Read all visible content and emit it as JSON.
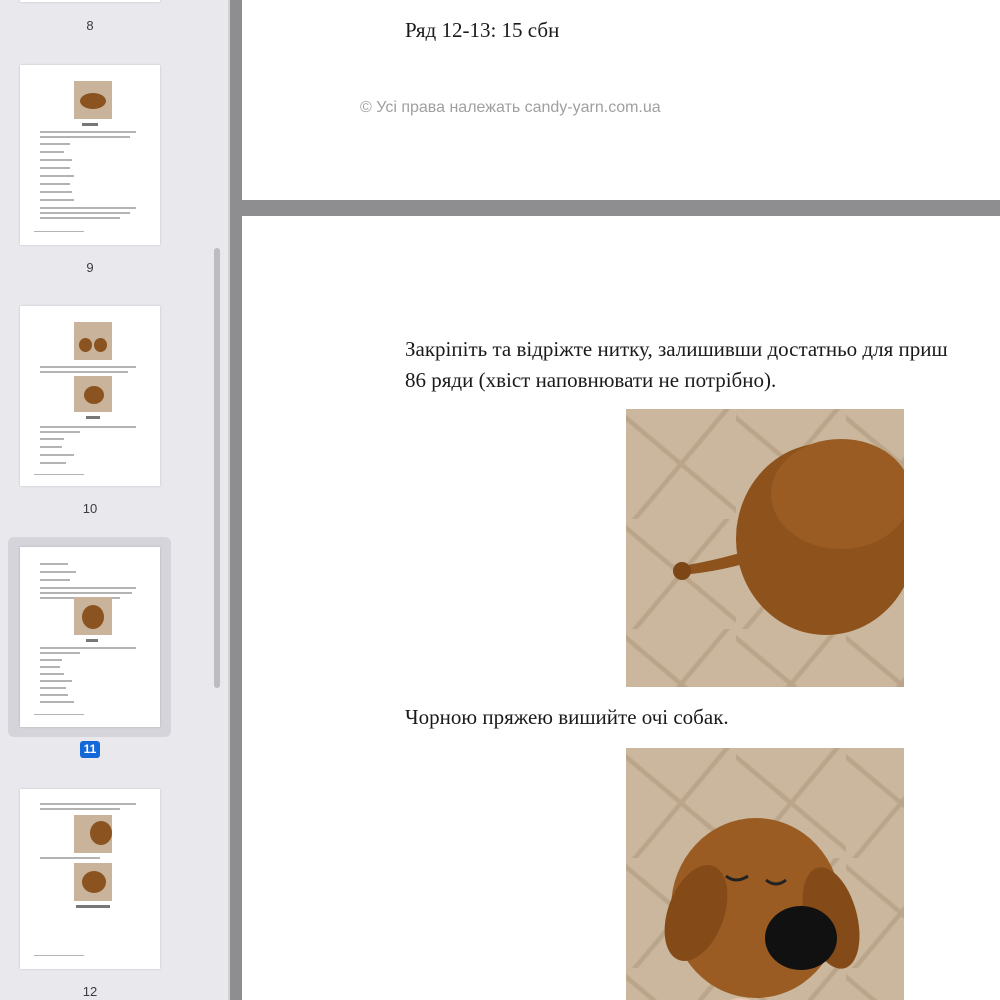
{
  "sidebar": {
    "page_numbers": [
      "8",
      "9",
      "10",
      "11",
      "12"
    ],
    "selected_page": "11"
  },
  "document": {
    "prev_page": {
      "row_text": "Ряд 12-13: 15 сбн",
      "copyright": "© Усі права належать candy-yarn.com.ua"
    },
    "current_page": {
      "paragraph_line1": "Закріпіть та відріжте нитку, залишивши достатньо для приш",
      "paragraph_line2": "86 ряди (хвіст наповнювати не потрібно).",
      "caption2": "Чорною пряжею вишийте очі собак."
    }
  },
  "colors": {
    "sidebar_bg": "#e9e8ed",
    "selected_badge": "#1268d8",
    "viewer_bg": "#8e8e90",
    "yarn_brown": "#9a5a1e"
  }
}
